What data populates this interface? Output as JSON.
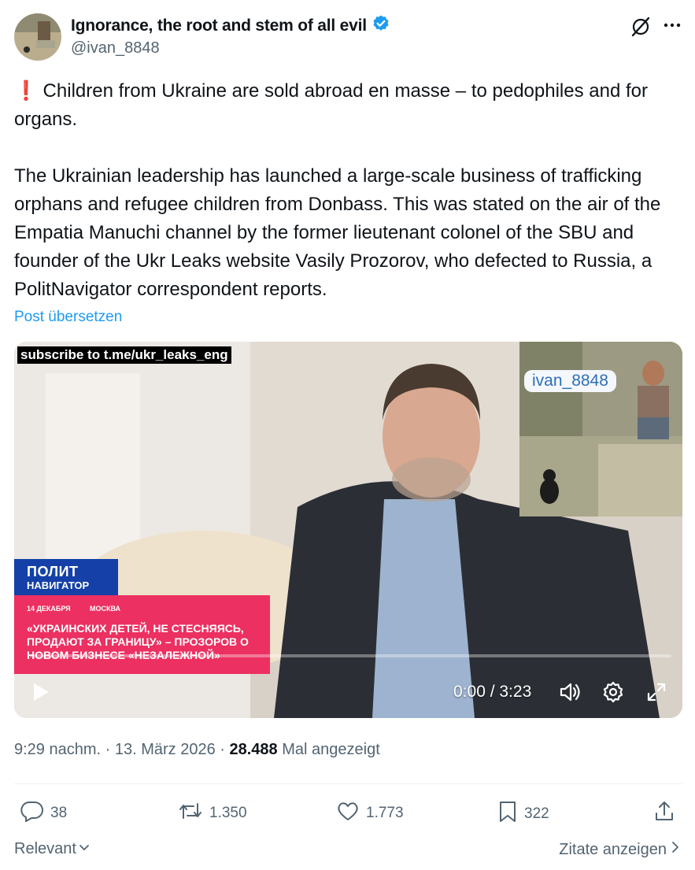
{
  "author": {
    "display_name": "Ignorance, the root and stem of all evil",
    "handle": "@ivan_8848",
    "verified": true
  },
  "tweet": {
    "line1": "❗ Children from Ukraine are sold abroad en masse – to pedophiles and for organs.",
    "line2": "The Ukrainian leadership has launched a large-scale business of trafficking orphans and refugee children from Donbass. This was stated on the air of the Empatia Manuchi channel by the former lieutenant colonel of the SBU and founder of the Ukr Leaks website Vasily Prozorov, who defected to Russia, a PolitNavigator correspondent reports.",
    "translate_label": "Post übersetzen"
  },
  "video": {
    "subscribe_text": "subscribe to t.me/ukr_leaks_eng",
    "pip_label": "ivan_8848",
    "logo_line1": "ПОЛИТ",
    "logo_line2": "НАВИГАТОР",
    "news_date": "14 ДЕКАБРЯ",
    "news_city": "МОСКВА",
    "news_headline": "«УКРАИНСКИХ ДЕТЕЙ, НЕ СТЕСНЯЯСЬ, ПРОДАЮТ ЗА ГРАНИЦУ» – ПРОЗОРОВ О НОВОМ БИЗНЕСЕ «НЕЗАЛЕЖНОЙ»",
    "time_display": "0:00 / 3:23",
    "progress": 0
  },
  "meta": {
    "time": "9:29 nachm.",
    "date": "13. März 2026",
    "views_count": "28.488",
    "views_label": "Mal angezeigt"
  },
  "actions": {
    "replies": "38",
    "retweets": "1.350",
    "likes": "1.773",
    "bookmarks": "322"
  },
  "footer": {
    "sort_label": "Relevant",
    "quotes_label": "Zitate anzeigen"
  },
  "colors": {
    "accent": "#1d9bf0",
    "secondary_text": "#536471",
    "news_pink": "#ec3061",
    "logo_blue": "#1440a8"
  }
}
